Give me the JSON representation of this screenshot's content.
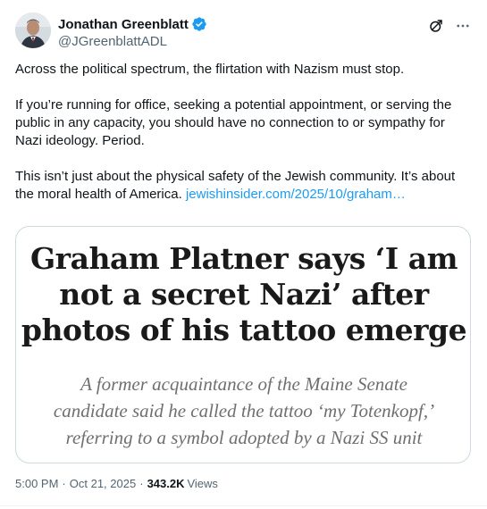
{
  "author": {
    "display_name": "Jonathan Greenblatt",
    "handle": "@JGreenblattADL",
    "verified_icon": "verified-badge-icon",
    "verified_color": "#1d9bf0"
  },
  "actions": {
    "grok_icon": "grok-icon",
    "more_icon": "more-icon"
  },
  "tweet": {
    "paragraph1": "Across the political spectrum, the flirtation with Nazism must stop.",
    "paragraph2": "If you’re running for office, seeking a potential appointment, or serving the public in any capacity, you should have no connection to or sympathy for Nazi ideology. Period.",
    "paragraph3": "This isn’t just about the physical safety of the Jewish community. It’s about the moral health of America.",
    "link_text": "jewishinsider.com/2025/10/graham…",
    "link_color": "#1d9bf0"
  },
  "card": {
    "headline_line1": "Graham Platner says ‘I am",
    "headline_line2": "not a secret Nazi’ after",
    "headline_line3": "photos of his tattoo emerge",
    "sub_line1": "A former acquaintance of the Maine Senate",
    "sub_line2": "candidate said he called the tattoo ‘my Totenkopf,’",
    "sub_line3": "referring to a symbol adopted by a Nazi SS unit"
  },
  "meta": {
    "time": "5:00 PM",
    "separator": "·",
    "date": "Oct 21, 2025",
    "separator2": "·",
    "views_count": "343.2K",
    "views_label": "Views"
  }
}
